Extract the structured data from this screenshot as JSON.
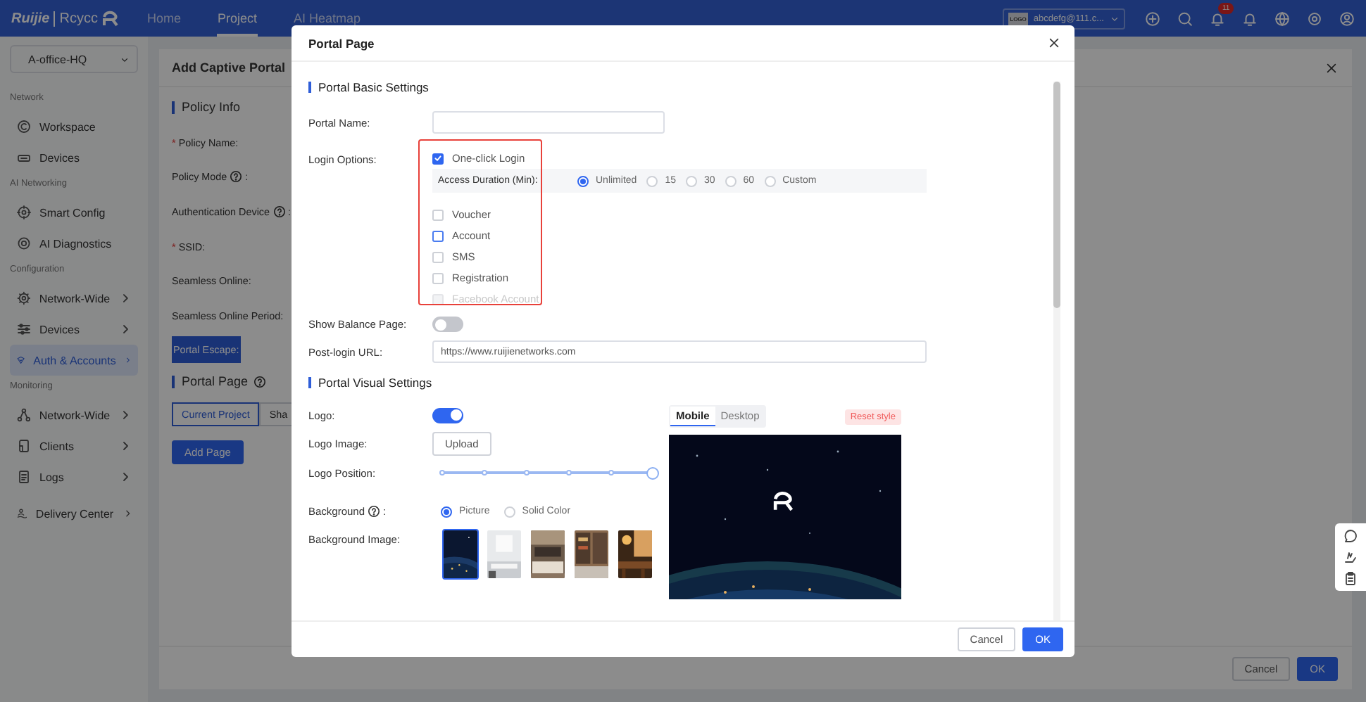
{
  "topbar": {
    "brand": "Ruijie",
    "product": "Rcycc",
    "nav": [
      {
        "label": "Home",
        "selected": false
      },
      {
        "label": "Project",
        "selected": true
      },
      {
        "label": "AI Heatmap",
        "selected": false
      }
    ],
    "account": {
      "logo": "LOGO",
      "email": "abcdefg@111.c..."
    },
    "notification_count": "11"
  },
  "sidebar": {
    "site": "A-office-HQ",
    "sections": [
      {
        "title": "Network",
        "items": [
          {
            "label": "Workspace",
            "expandable": false,
            "selected": false
          },
          {
            "label": "Devices",
            "expandable": false,
            "selected": false
          }
        ]
      },
      {
        "title": "AI Networking",
        "items": [
          {
            "label": "Smart Config",
            "expandable": false,
            "selected": false
          },
          {
            "label": "AI Diagnostics",
            "expandable": false,
            "selected": false
          }
        ]
      },
      {
        "title": "Configuration",
        "items": [
          {
            "label": "Network-Wide",
            "expandable": true,
            "selected": false
          },
          {
            "label": "Devices",
            "expandable": true,
            "selected": false
          },
          {
            "label": "Auth & Accounts",
            "expandable": true,
            "selected": true
          }
        ]
      },
      {
        "title": "Monitoring",
        "items": [
          {
            "label": "Network-Wide",
            "expandable": true,
            "selected": false
          },
          {
            "label": "Clients",
            "expandable": true,
            "selected": false
          },
          {
            "label": "Logs",
            "expandable": true,
            "selected": false
          },
          {
            "label": "Delivery Center",
            "expandable": true,
            "selected": false
          }
        ]
      }
    ]
  },
  "background_page": {
    "title": "Add Captive Portal",
    "section": "Policy Info",
    "fields": [
      {
        "label": "Policy Name:",
        "marker": "*",
        "help": false,
        "highlighted": false
      },
      {
        "label": "Policy Mode",
        "help": true,
        "after_help": ":",
        "highlighted": false
      },
      {
        "label": "Authentication Device",
        "help": true,
        "after_help": ":",
        "highlighted": false
      },
      {
        "label": "SSID:",
        "marker": "*",
        "help": false,
        "highlighted": false
      },
      {
        "label": "Seamless Online:",
        "help": false,
        "highlighted": false
      },
      {
        "label": "Seamless Online Period:",
        "help": false,
        "highlighted": false
      },
      {
        "label": "Portal Escape:",
        "help": false,
        "highlighted": true
      }
    ],
    "portal_page": {
      "title": "Portal Page",
      "help": true,
      "tabs": [
        {
          "label": "Current Project",
          "selected": true
        },
        {
          "label": "Sha",
          "selected": false
        }
      ],
      "add_button": "Add Page"
    },
    "buttons": [
      {
        "label": "Cancel",
        "kind": "secondary"
      },
      {
        "label": "OK",
        "kind": "primary"
      }
    ]
  },
  "modal": {
    "title": "Portal Page",
    "basic": {
      "heading": "Portal Basic Settings",
      "portal_name": {
        "label": "Portal Name:"
      },
      "login_options": {
        "label": "Login Options:",
        "options": [
          {
            "label": "One-click Login",
            "checked": true,
            "focused": false,
            "disabled": false,
            "access_duration": {
              "label": "Access Duration (Min):",
              "choices": [
                {
                  "label": "Unlimited",
                  "selected": true
                },
                {
                  "label": "15",
                  "selected": false
                },
                {
                  "label": "30",
                  "selected": false
                },
                {
                  "label": "60",
                  "selected": false
                },
                {
                  "label": "Custom",
                  "selected": false
                }
              ]
            }
          },
          {
            "label": "Voucher",
            "checked": false,
            "focused": false,
            "disabled": false
          },
          {
            "label": "Account",
            "checked": false,
            "focused": true,
            "disabled": false
          },
          {
            "label": "SMS",
            "checked": false,
            "focused": false,
            "disabled": false
          },
          {
            "label": "Registration",
            "checked": false,
            "focused": false,
            "disabled": false
          },
          {
            "label": "Facebook Account",
            "checked": false,
            "focused": false,
            "disabled": true
          }
        ]
      },
      "show_balance": {
        "label": "Show Balance Page:",
        "on": false
      },
      "post_login_url": {
        "label": "Post-login URL:",
        "value": "https://www.ruijienetworks.com"
      }
    },
    "visual": {
      "heading": "Portal Visual Settings",
      "logo": {
        "label": "Logo:",
        "on": true
      },
      "logo_image": {
        "label": "Logo Image:",
        "button": "Upload"
      },
      "logo_position": {
        "label": "Logo Position:",
        "level": 1
      },
      "background": {
        "label": "Background",
        "help": true,
        "after_help": ":",
        "choices": [
          {
            "label": "Picture",
            "selected": true
          },
          {
            "label": "Solid Color",
            "selected": false
          }
        ]
      },
      "background_image": {
        "label": "Background Image:",
        "images": [
          {
            "kind": "picture",
            "selected": true
          },
          {
            "kind": "picture",
            "selected": false
          },
          {
            "kind": "picture",
            "selected": false
          },
          {
            "kind": "picture",
            "selected": false
          },
          {
            "kind": "picture",
            "selected": false
          }
        ]
      },
      "preview": {
        "tabs": [
          {
            "label": "Mobile",
            "selected": true
          },
          {
            "label": "Desktop",
            "selected": false
          }
        ],
        "reset": "Reset style"
      }
    },
    "buttons": [
      {
        "label": "Cancel",
        "kind": "secondary"
      },
      {
        "label": "OK",
        "kind": "primary"
      }
    ]
  }
}
